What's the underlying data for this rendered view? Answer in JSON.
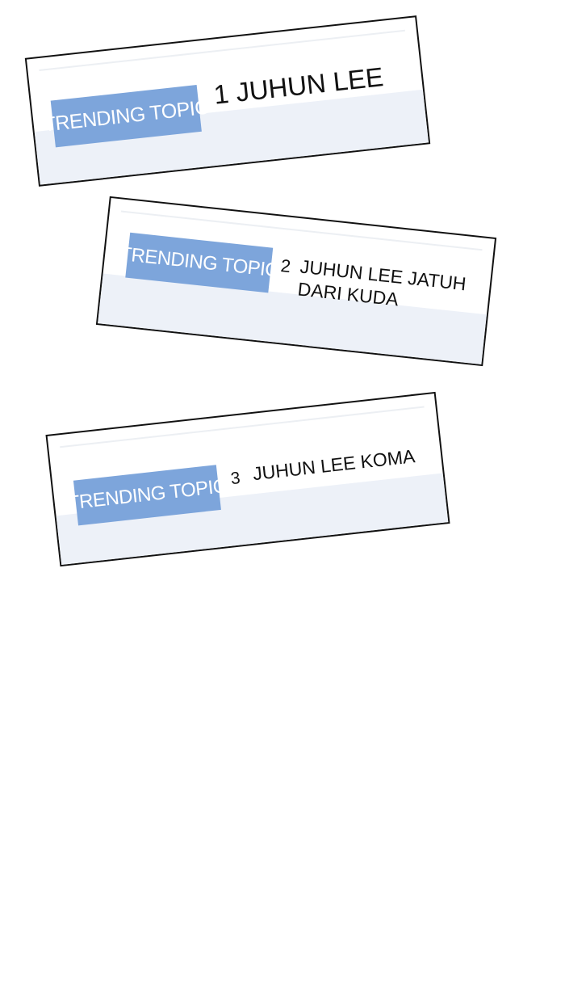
{
  "colors": {
    "tag_background": "#7da5db",
    "tag_text": "#ffffff",
    "panel_band": "#edf1f8",
    "border": "#111111"
  },
  "panels": [
    {
      "tag": "TRENDING TOPIC",
      "headline": "1 JUHUN LEE"
    },
    {
      "tag": "TRENDING TOPIC",
      "number": "2",
      "headline": "JUHUN LEE JATUH DARI KUDA"
    },
    {
      "tag": "TRENDING TOPIC",
      "number": "3",
      "headline": "JUHUN LEE KOMA"
    }
  ]
}
